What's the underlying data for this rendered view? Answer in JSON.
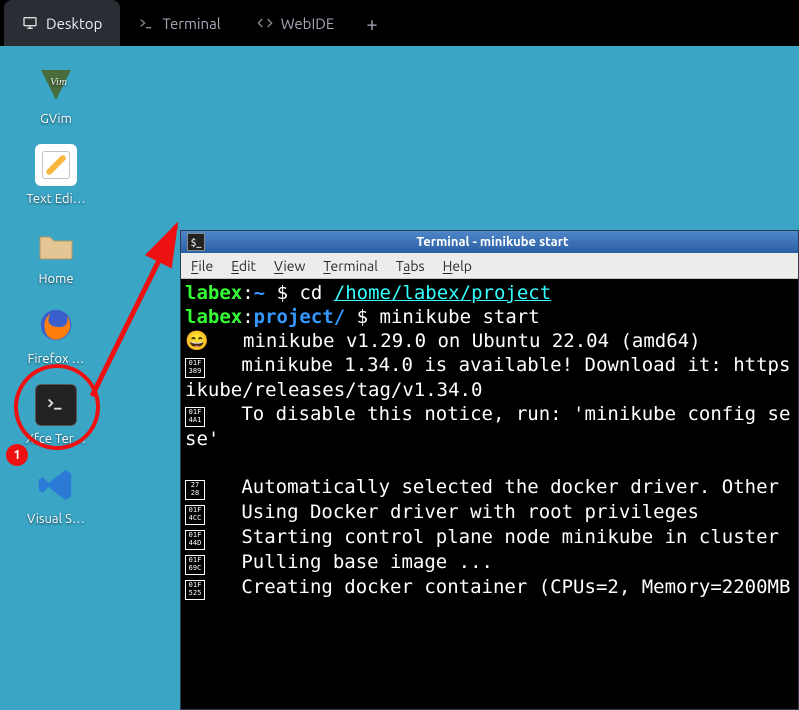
{
  "tabs": [
    {
      "label": "Desktop",
      "icon": "monitor"
    },
    {
      "label": "Terminal",
      "icon": "prompt"
    },
    {
      "label": "WebIDE",
      "icon": "code"
    }
  ],
  "desktop_icons": {
    "gvim": {
      "label": "GVim"
    },
    "textedit": {
      "label": "Text Edi…"
    },
    "home": {
      "label": "Home"
    },
    "firefox": {
      "label": "Firefox …"
    },
    "xfce": {
      "label": "Xfce Ter…"
    },
    "vscode": {
      "label": "Visual S…"
    }
  },
  "annotation": {
    "step_number": "1"
  },
  "terminal_window": {
    "title": "Terminal - minikube start",
    "menu": [
      "File",
      "Edit",
      "View",
      "Terminal",
      "Tabs",
      "Help"
    ],
    "prompt1": {
      "user": "labex",
      "cwd": "~",
      "sep": ":",
      "sigil": "$",
      "cmd_pre": "cd ",
      "cmd_path": "/home/labex/project"
    },
    "prompt2": {
      "user": "labex",
      "cwd": "project/",
      "sep": ":",
      "sigil": "$",
      "cmd": "minikube start"
    },
    "glyphs": {
      "g1": "😄",
      "g2": "01F\n389",
      "g3": "01F\n4A1",
      "g4": "27\n28",
      "g5": "01F\n4CC",
      "g6": "01F\n44D",
      "g7": "01F\n69C",
      "g8": "01F\n525"
    },
    "lines": {
      "l1": "  minikube v1.29.0 on Ubuntu 22.04 (amd64)",
      "l2": "  minikube 1.34.0 is available! Download it: https",
      "l3": "ikube/releases/tag/v1.34.0",
      "l4": "  To disable this notice, run: 'minikube config se",
      "l5": "se'",
      "l6": "  Automatically selected the docker driver. Other ",
      "l7": "  Using Docker driver with root privileges",
      "l8": "  Starting control plane node minikube in cluster ",
      "l9": "  Pulling base image ...",
      "l10": "  Creating docker container (CPUs=2, Memory=2200MB"
    }
  }
}
